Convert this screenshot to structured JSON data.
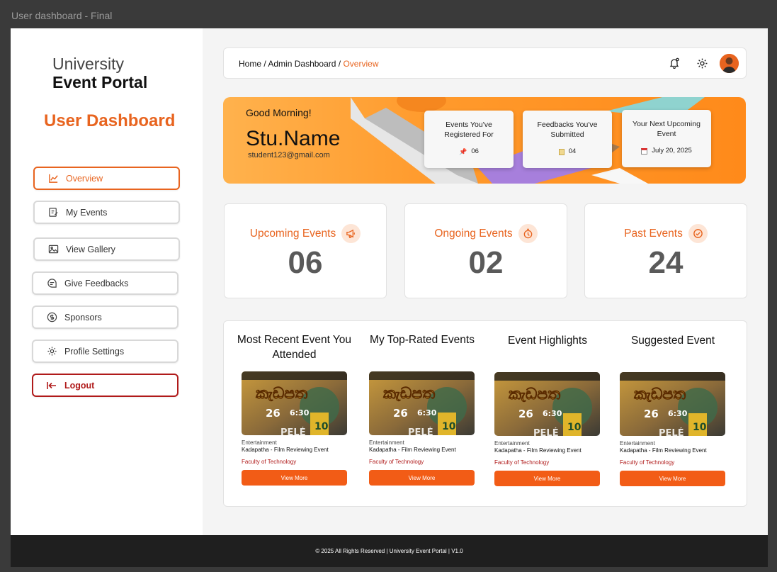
{
  "window": {
    "title": "User dashboard - Final"
  },
  "brand": {
    "line1": "University",
    "line2": "Event Portal"
  },
  "sidebar": {
    "title": "User Dashboard",
    "items": [
      {
        "label": "Overview",
        "icon": "chart-line-icon"
      },
      {
        "label": "My Events",
        "icon": "edit-doc-icon"
      },
      {
        "label": "View Gallery",
        "icon": "image-icon"
      },
      {
        "label": "Give Feedbacks",
        "icon": "chat-icon"
      },
      {
        "label": "Sponsors",
        "icon": "dollar-circle-icon"
      },
      {
        "label": "Profile Settings",
        "icon": "gear-icon"
      },
      {
        "label": "Logout",
        "icon": "logout-icon"
      }
    ]
  },
  "breadcrumb": {
    "home": "Home",
    "sep": "/",
    "admin": "Admin Dashboard",
    "current": "Overview"
  },
  "hero": {
    "greeting": "Good Morning!",
    "name": "Stu.Name",
    "email": "student123@gmail.com",
    "cards": [
      {
        "label": "Events You've Registered For",
        "value": "06",
        "icon": "pin-icon"
      },
      {
        "label": "Feedbacks You've Submitted",
        "value": "04",
        "icon": "note-icon"
      },
      {
        "label": "Your Next Upcoming Event",
        "value": "July 20, 2025",
        "icon": "calendar-icon"
      }
    ]
  },
  "stats": [
    {
      "label": "Upcoming Events",
      "value": "06",
      "icon": "megaphone-icon"
    },
    {
      "label": "Ongoing Events",
      "value": "02",
      "icon": "stopwatch-icon"
    },
    {
      "label": "Past Events",
      "value": "24",
      "icon": "check-circle-icon"
    }
  ],
  "events": [
    {
      "heading": "Most Recent Event You Attended",
      "category": "Entertainment",
      "title": "Kadapatha - Film Reviewing Event",
      "faculty": "Faculty of Technology",
      "button": "View More"
    },
    {
      "heading": "My Top-Rated Events",
      "category": "Entertainment",
      "title": "Kadapatha - Film Reviewing Event",
      "faculty": "Faculty of Technology",
      "button": "View More"
    },
    {
      "heading": "Event Highlights",
      "category": "Entertainment",
      "title": "Kadapatha - Film Reviewing Event",
      "faculty": "Faculty of Technology",
      "button": "View More"
    },
    {
      "heading": "Suggested Event",
      "category": "Entertainment",
      "title": "Kadapatha - Film Reviewing Event",
      "faculty": "Faculty of Technology",
      "button": "View More"
    }
  ],
  "poster": {
    "title": "කැඩපත",
    "date": "26",
    "time": "6:30",
    "banner": "PELÉ"
  },
  "footer": {
    "text": "© 2025 All Rights Reserved | University Event Portal | V1.0"
  },
  "colors": {
    "accent": "#e8641f",
    "danger": "#b01a1a",
    "button": "#f25c16"
  }
}
